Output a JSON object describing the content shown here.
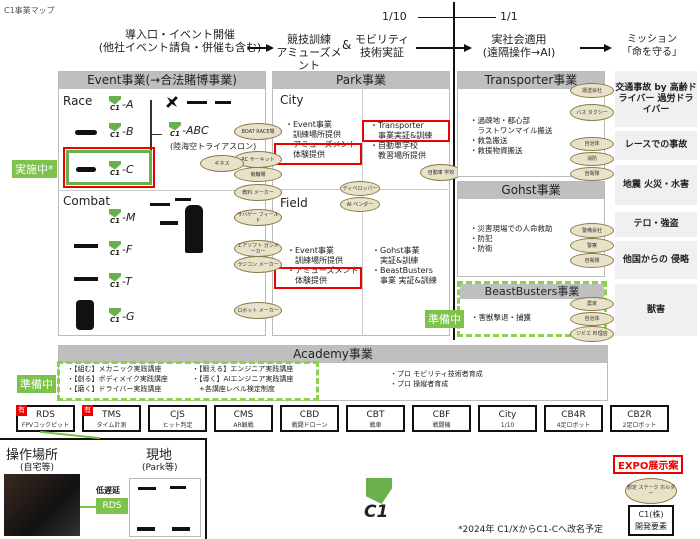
{
  "page_title": "C1事業マップ",
  "flow": {
    "stage1": [
      "導入口・イベント開催",
      "(他社イベント請負・併催も含む)"
    ],
    "stage2": [
      "競技訓練",
      "アミューズメント"
    ],
    "amp": "&",
    "stage3": [
      "モビリティ",
      "技術実証"
    ],
    "stage4": [
      "実社会適用",
      "(遠隔操作→AI)"
    ],
    "stage5": [
      "ミッション",
      "「命を守る」"
    ],
    "scale_left": "1/10",
    "scale_right": "1/1"
  },
  "event": {
    "header": "Event事業(→合法賭博事業)",
    "race_label": "Race",
    "combat_label": "Combat",
    "race_items": [
      "-A",
      "-B",
      "-C"
    ],
    "abc": "-ABC",
    "abc_sub": "(陸海空トライアスロン)",
    "combat_items": [
      "-M",
      "-F",
      "-T",
      "-G"
    ],
    "status": "実施中*",
    "logo_text": "C1"
  },
  "park": {
    "header": "Park事業",
    "city_label": "City",
    "field_label": "Field",
    "city_left": [
      "・Event事業",
      "　訓練場所提供",
      "・アミューズメント",
      "　体験提供"
    ],
    "city_right": [
      "・Transporter",
      "　事業実証&訓練",
      "・自動車学校",
      "　教習場所提供"
    ],
    "field_left": [
      "・Event事業",
      "　訓練場所提供",
      "・アミューズメント",
      "　体験提供"
    ],
    "field_right": [
      "・Gohst事業",
      "　実証&訓練",
      "・BeastBusters",
      "　事業 実証&訓練"
    ]
  },
  "stakeholders": {
    "boat": "BOAT RACE場",
    "rc": "RC サーキット",
    "keirin": "競輪場",
    "ginesu": "ギネス",
    "kyozai": "教料 メーカー",
    "saiga": "サバゲー フィールド",
    "airsoft": "エアソフト ガンメーカー",
    "radicon": "ラジコン メーカー",
    "robot": "ロボット メーカー",
    "developer": "ディベロッパー",
    "ai_vendor": "AI ベンダー",
    "driving_school": "自動車 学校",
    "transport_co": "運送会社",
    "bus_taxi": "バス タクシー",
    "municipality": "自治体",
    "fire": "消防",
    "sdf": "自衛隊",
    "security_co": "警備会社",
    "police": "警察",
    "sdf2": "自衛隊",
    "farmer": "農家",
    "municipality2": "自治体",
    "gibier": "ジビエ 料理店",
    "expo_holder": "想定 ステーク ホルダー"
  },
  "transporter": {
    "header": "Transporter事業",
    "items": [
      "・過疎地・都心部",
      "　ラストワンマイル搬送",
      "・救急搬送",
      "・救援物資搬送"
    ]
  },
  "gohst": {
    "header": "Gohst事業",
    "items": [
      "・災害現場での人命救助",
      "・防犯",
      "・防衛"
    ]
  },
  "beast": {
    "header": "BeastBusters事業",
    "items": [
      "・害獣撃退・捕獲"
    ],
    "status": "準備中"
  },
  "missions": [
    "交通事故 by 高齢ドライバー 過労ドライバー",
    "レースでの事故",
    "地震 火災・水害",
    "テロ・強盗",
    "他国からの 侵略",
    "獣害"
  ],
  "academy": {
    "header": "Academy事業",
    "status": "準備中",
    "left": [
      "・【組む】メカニック実践講座",
      "・【創る】ボディメイク実践講座",
      "・【磨く】ドライバー実践講座"
    ],
    "mid": [
      "・【鍛える】エンジニア実践講座",
      "・【導く】AIエンジニア実践講座",
      "　+各講座レベル検定制度"
    ],
    "right": [
      "・プロ モビリティ技術者育成",
      "・プロ 操縦者育成"
    ]
  },
  "products": [
    {
      "name": "RDS",
      "sub": "FPVコックピット",
      "badge": "有"
    },
    {
      "name": "TMS",
      "sub": "タイム計測",
      "badge": "有"
    },
    {
      "name": "CJS",
      "sub": "ヒット判定",
      "badge": ""
    },
    {
      "name": "CMS",
      "sub": "AR観戦",
      "badge": ""
    },
    {
      "name": "CBD",
      "sub": "戦闘ドローン",
      "badge": ""
    },
    {
      "name": "CBT",
      "sub": "戦車",
      "badge": ""
    },
    {
      "name": "CBF",
      "sub": "戦闘機",
      "badge": ""
    },
    {
      "name": "City",
      "sub": "1/10",
      "badge": ""
    },
    {
      "name": "CB4R",
      "sub": "4足ロボット",
      "badge": ""
    },
    {
      "name": "CB2R",
      "sub": "2足ロボット",
      "badge": ""
    }
  ],
  "rds_detail": {
    "op_title": "操作場所",
    "op_sub": "(自宅等)",
    "site_title": "現地",
    "site_sub": "(Park等)",
    "latency": "低遅延",
    "rds": "RDS"
  },
  "footer": {
    "logo": "C1",
    "note": "*2024年 C1/XからC1-Cへ改名予定",
    "expo": "EXPO展示案",
    "c1_box": [
      "C1(株)",
      "開発要素"
    ]
  },
  "colors": {
    "accent_green": "#7cc24b",
    "highlight_red": "#e00000",
    "header_gray": "#bfbfbf"
  }
}
